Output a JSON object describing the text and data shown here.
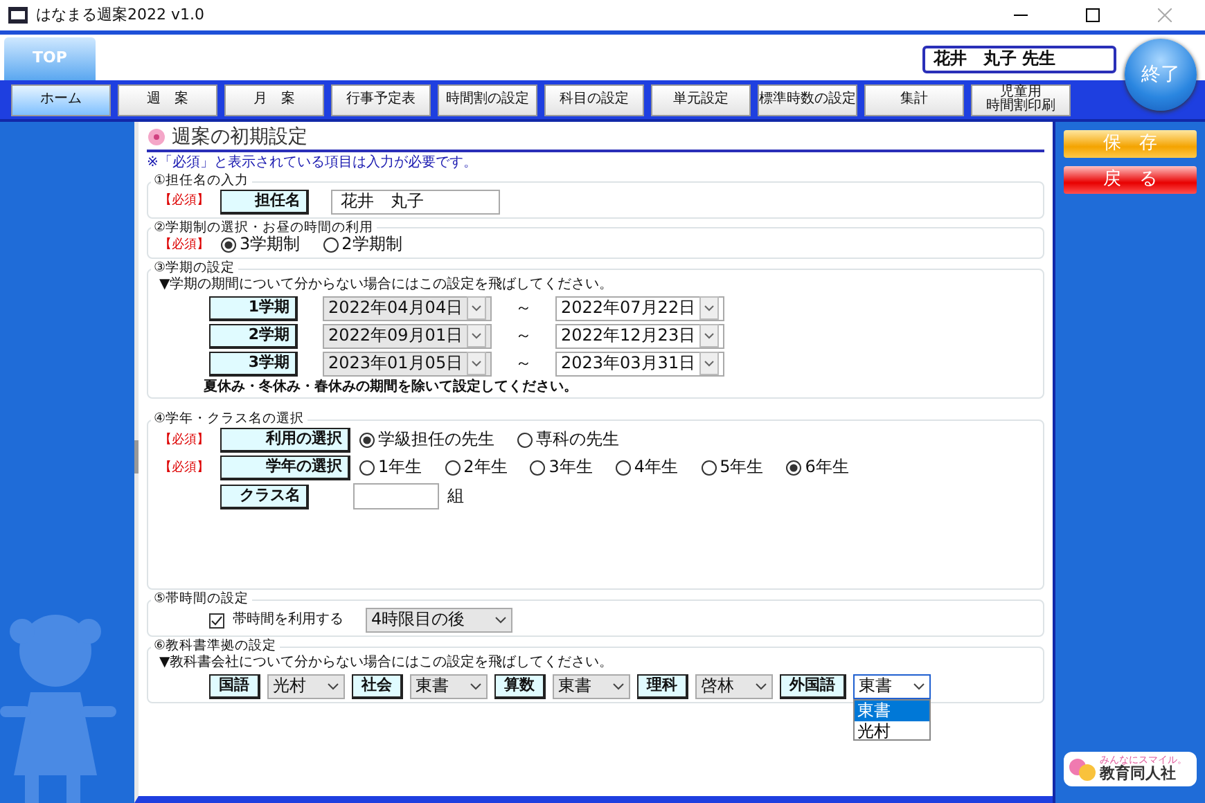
{
  "window": {
    "title": "はなまる週案2022 v1.0"
  },
  "top_tab": "TOP",
  "user_name": "花井　丸子 先生",
  "exit_button": "終了",
  "nav": [
    {
      "label": "ホーム",
      "selected": true
    },
    {
      "label": "週　案",
      "selected": false
    },
    {
      "label": "月　案",
      "selected": false
    },
    {
      "label": "行事予定表",
      "selected": false
    },
    {
      "label": "時間割の設定",
      "selected": false
    },
    {
      "label": "科目の設定",
      "selected": false
    },
    {
      "label": "単元設定",
      "selected": false
    },
    {
      "label": "標準時数の設定",
      "selected": false
    },
    {
      "label": "集計",
      "selected": false
    },
    {
      "label_lines": [
        "児童用",
        "時間割印刷"
      ],
      "selected": false
    }
  ],
  "page_title": "週案の初期設定",
  "note": "※「必須」と表示されている項目は入力が必要です。",
  "teacher": {
    "legend": "①担任名の入力",
    "required": "【必須】",
    "label": "担任名",
    "value": "花井　丸子"
  },
  "term_system": {
    "legend": "②学期制の選択・お昼の時間の利用",
    "required": "【必須】",
    "options": [
      {
        "label": "3学期制",
        "selected": true
      },
      {
        "label": "2学期制",
        "selected": false
      }
    ]
  },
  "terms": {
    "legend": "③学期の設定",
    "hint": "▼学期の期間について分からない場合にはこの設定を飛ばしてください。",
    "rows": [
      {
        "label": "1学期",
        "start": "2022年04月04日",
        "separator": "～",
        "end": "2022年07月22日"
      },
      {
        "label": "2学期",
        "start": "2022年09月01日",
        "separator": "～",
        "end": "2022年12月23日"
      },
      {
        "label": "3学期",
        "start": "2023年01月05日",
        "separator": "～",
        "end": "2023年03月31日"
      }
    ],
    "footnote": "夏休み・冬休み・春休みの期間を除いて設定してください。"
  },
  "grade_class": {
    "legend": "④学年・クラス名の選択",
    "usage": {
      "required": "【必須】",
      "label": "利用の選択",
      "options": [
        {
          "label": "学級担任の先生",
          "selected": true
        },
        {
          "label": "専科の先生",
          "selected": false
        }
      ]
    },
    "grade": {
      "required": "【必須】",
      "label": "学年の選択",
      "options": [
        {
          "label": "1年生",
          "selected": false
        },
        {
          "label": "2年生",
          "selected": false
        },
        {
          "label": "3年生",
          "selected": false
        },
        {
          "label": "4年生",
          "selected": false
        },
        {
          "label": "5年生",
          "selected": false
        },
        {
          "label": "6年生",
          "selected": true
        }
      ]
    },
    "class_name": {
      "label": "クラス名",
      "suffix": "組"
    }
  },
  "band_time": {
    "legend": "⑤帯時間の設定",
    "checkbox": {
      "label": "帯時間を利用する",
      "checked": true
    },
    "select": "4時限目の後"
  },
  "textbooks": {
    "legend": "⑥教科書準拠の設定",
    "hint": "▼教科書会社について分からない場合にはこの設定を飛ばしてください。",
    "subjects": [
      {
        "label": "国語",
        "value": "光村",
        "open": false
      },
      {
        "label": "社会",
        "value": "東書",
        "open": false
      },
      {
        "label": "算数",
        "value": "東書",
        "open": false
      },
      {
        "label": "理科",
        "value": "啓林",
        "open": false
      },
      {
        "label": "外国語",
        "value": "東書",
        "open": true
      }
    ],
    "dropdown": [
      {
        "label": "東書",
        "selected": true
      },
      {
        "label": "光村",
        "selected": false
      }
    ]
  },
  "side_buttons": [
    {
      "label": "保　存",
      "kind": "save"
    },
    {
      "label": "戻　る",
      "kind": "back"
    }
  ],
  "logo": {
    "tagline": "みんなにスマイル。",
    "name": "教育同人社"
  }
}
